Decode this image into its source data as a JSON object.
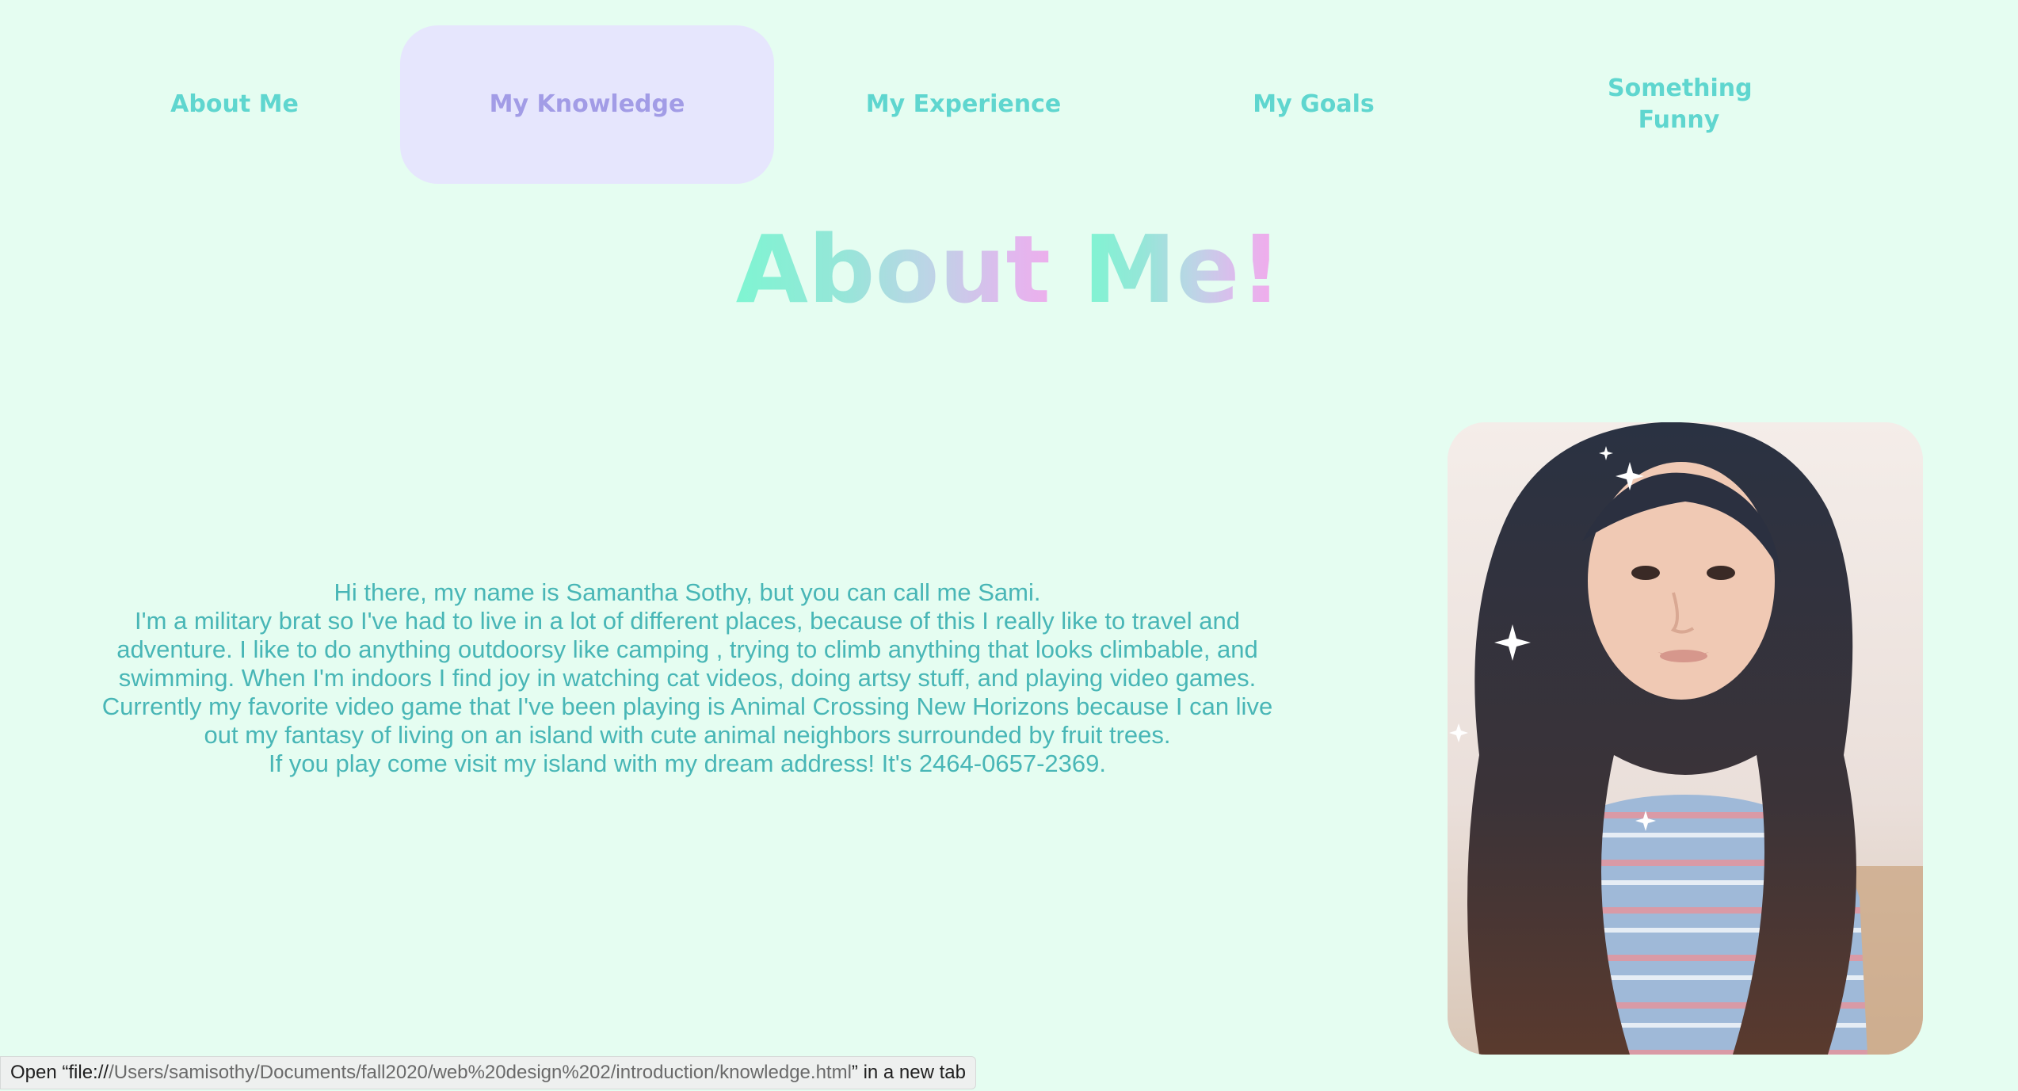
{
  "nav": {
    "items": [
      {
        "label_lines": [
          "About Me"
        ]
      },
      {
        "label_lines": [
          "My Knowledge"
        ]
      },
      {
        "label_lines": [
          "My Experience"
        ]
      },
      {
        "label_lines": [
          "My Goals"
        ]
      },
      {
        "label_lines": [
          "Something",
          "Funny"
        ]
      }
    ]
  },
  "page": {
    "title_part1": "About ",
    "title_part2": "Me!"
  },
  "bio": {
    "lines": [
      "Hi there, my name is Samantha Sothy, but you can call me Sami.",
      "I'm a military brat so I've had to live in a lot of different places, because of this I really like to travel and adventure. I like to do anything outdoorsy like camping , trying to climb anything that looks climbable, and swimming. When I'm indoors I find joy in watching cat videos, doing artsy stuff, and playing video games. Currently my favorite video game that I've been playing is Animal Crossing New Horizons because I can live out my fantasy of living on an island with cute animal neighbors surrounded by fruit trees.",
      "If you play come visit my island with my dream address! It's 2464-0657-2369."
    ]
  },
  "status": {
    "prefix": "Open “file://",
    "path": "/Users/samisothy/Documents/fall2020/web%20design%202/introduction/knowledge.html",
    "suffix": "” in a new tab"
  },
  "colors": {
    "background": "#e5fdf1",
    "nav_text": "#5fd6cf",
    "nav_active_bg": "#e6e6fd",
    "nav_active_text": "#a29ce6",
    "bio_text": "#48b6b6"
  }
}
